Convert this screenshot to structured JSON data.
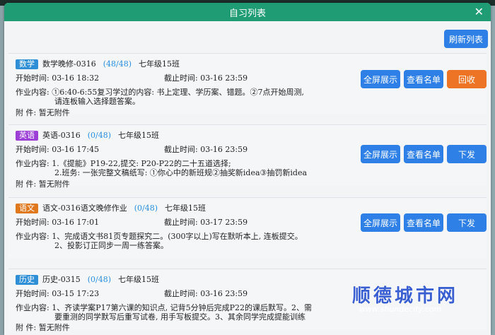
{
  "window": {
    "title": "自习列表",
    "close_label": "✕"
  },
  "refresh_label": "刷新列表",
  "cards": [
    {
      "tag": "数学",
      "tag_color": "#2e8fd6",
      "name": "数学晚修-0316",
      "count": "(48/48)",
      "class": "七年级15班",
      "start": "开始时间: 03-16 18:32",
      "end": "截止时间: 03-16 23:59",
      "content_label": "作业内容:",
      "content_lines": [
        "①6:40-6:55复习学过的内容: 书上定理、学历案、错题。②7点开始周测,",
        "请连板输入选择题答案。"
      ],
      "attach": "附    件: 暂无附件",
      "buttons": [
        "全屏展示",
        "查看名单",
        "回收"
      ]
    },
    {
      "tag": "英语",
      "tag_color": "#9b3fd6",
      "name": "英语-0316",
      "count": "(0/48)",
      "class": "七年级15班",
      "start": "开始时间: 03-16 17:45",
      "end": "截止时间: 03-16 23:59",
      "content_label": "作业内容:",
      "content_lines": [
        "1.《提能》P19-22,提交: P20-P22的二十五道选择;",
        "2.班务: 一张完整文稿纸写: ①你心中的新班规②抽奖新idea③抽罚新idea"
      ],
      "attach": "附    件: 暂无附件",
      "buttons": [
        "全屏展示",
        "查看名单",
        "下发"
      ]
    },
    {
      "tag": "语文",
      "tag_color": "#e0781e",
      "name": "语文-0316语文晚修作业",
      "count": "(0/48)",
      "class": "七年级15班",
      "start": "开始时间: 03-16 17:01",
      "end": "截止时间: 03-17 23:59",
      "content_label": "作业内容:",
      "content_lines": [
        "1、完成语文书81页专题探究二。(300字以上)写在默听本上, 连板提交。",
        "2、投影订正同步一周一练答案。"
      ],
      "attach": "附    件: 暂无附件",
      "buttons": [
        "全屏展示",
        "查看名单",
        "下发"
      ]
    },
    {
      "tag": "历史",
      "tag_color": "#2e8fd6",
      "name": "历史-0315",
      "count": "(0/48)",
      "class": "七年级15班",
      "start": "开始时间: 03-15 17:23",
      "end": "截止时间: 03-16 23:59",
      "content_label": "作业内容:",
      "content_lines": [
        "1、齐读学案P17第六课的知识点, 记背5分钟后完成P22的课后默写。2、需",
        "要重测的同学默写后重写试卷, 用手写板提交。3、其余同学完成提能训练"
      ],
      "attach": "附    件: 暂无附件",
      "buttons": []
    }
  ],
  "watermark": {
    "cn": "顺德城市网",
    "url": "www.shundecity.com"
  }
}
